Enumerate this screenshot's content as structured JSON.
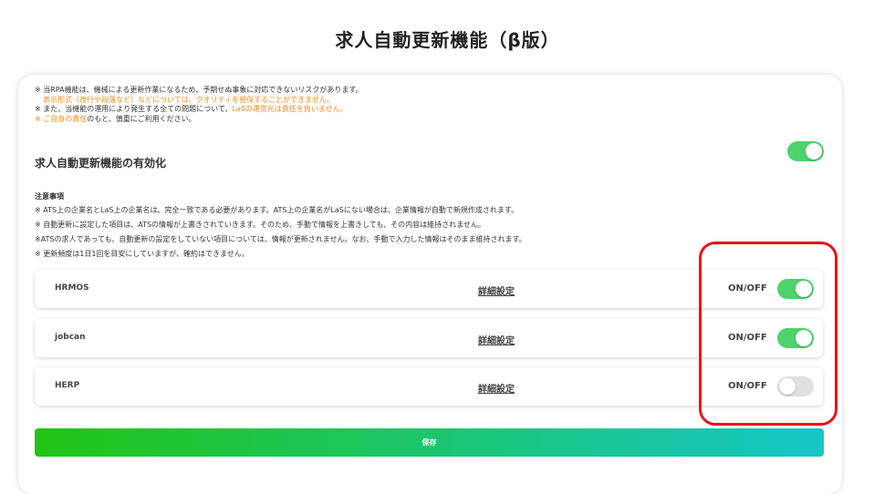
{
  "page": {
    "title": "求人自動更新機能（β版）"
  },
  "warning": {
    "line1": "※ 当RPA機能は、機械による更新作業になるため、予期せぬ事象に対応できないリスクがあります。",
    "line2": "表示形式（改行や段落など）などについては、クオリティを担保することができません。",
    "line3_prefix": "※ また、当機能の運用により発生する全ての問題について、",
    "line3_orange": "LaSの運営元は責任を負いません。",
    "line4_orange": "※ ご自身の責任",
    "line4_suffix": "のもと、慎重にご利用ください。"
  },
  "enable": {
    "label": "求人自動更新機能の有効化",
    "state": "on"
  },
  "notes": {
    "title": "注意事項",
    "items": [
      "※ ATS上の企業名とLaS上の企業名は、完全一致である必要があります。ATS上の企業名がLaSにない場合は、企業情報が自動で新規作成されます。",
      "※ 自動更新に設定した項目は、ATSの情報が上書きされていきます。そのため、手動で情報を上書きしても、その内容は維持されません。",
      "※ATSの求人であっても、自動更新の設定をしていない項目については、情報が更新されません。なお、手動で入力した情報はそのまま維持されます。",
      "※ 更新頻度は1日1回を目安にしていますが、確約はできません。"
    ]
  },
  "ats_rows": [
    {
      "name": "HRMOS",
      "detail_label": "詳細設定",
      "onoff_label": "ON/OFF",
      "state": "on"
    },
    {
      "name": "jobcan",
      "detail_label": "詳細設定",
      "onoff_label": "ON/OFF",
      "state": "on"
    },
    {
      "name": "HERP",
      "detail_label": "詳細設定",
      "onoff_label": "ON/OFF",
      "state": "off"
    }
  ],
  "save_button": {
    "label": "保存"
  },
  "colors": {
    "toggle_on": "#4cd36b",
    "toggle_off": "#e0e0e0",
    "warning_orange": "#f28c1a",
    "highlight_red": "#e8141b",
    "save_gradient_start": "#22c514",
    "save_gradient_end": "#15c6c8"
  }
}
